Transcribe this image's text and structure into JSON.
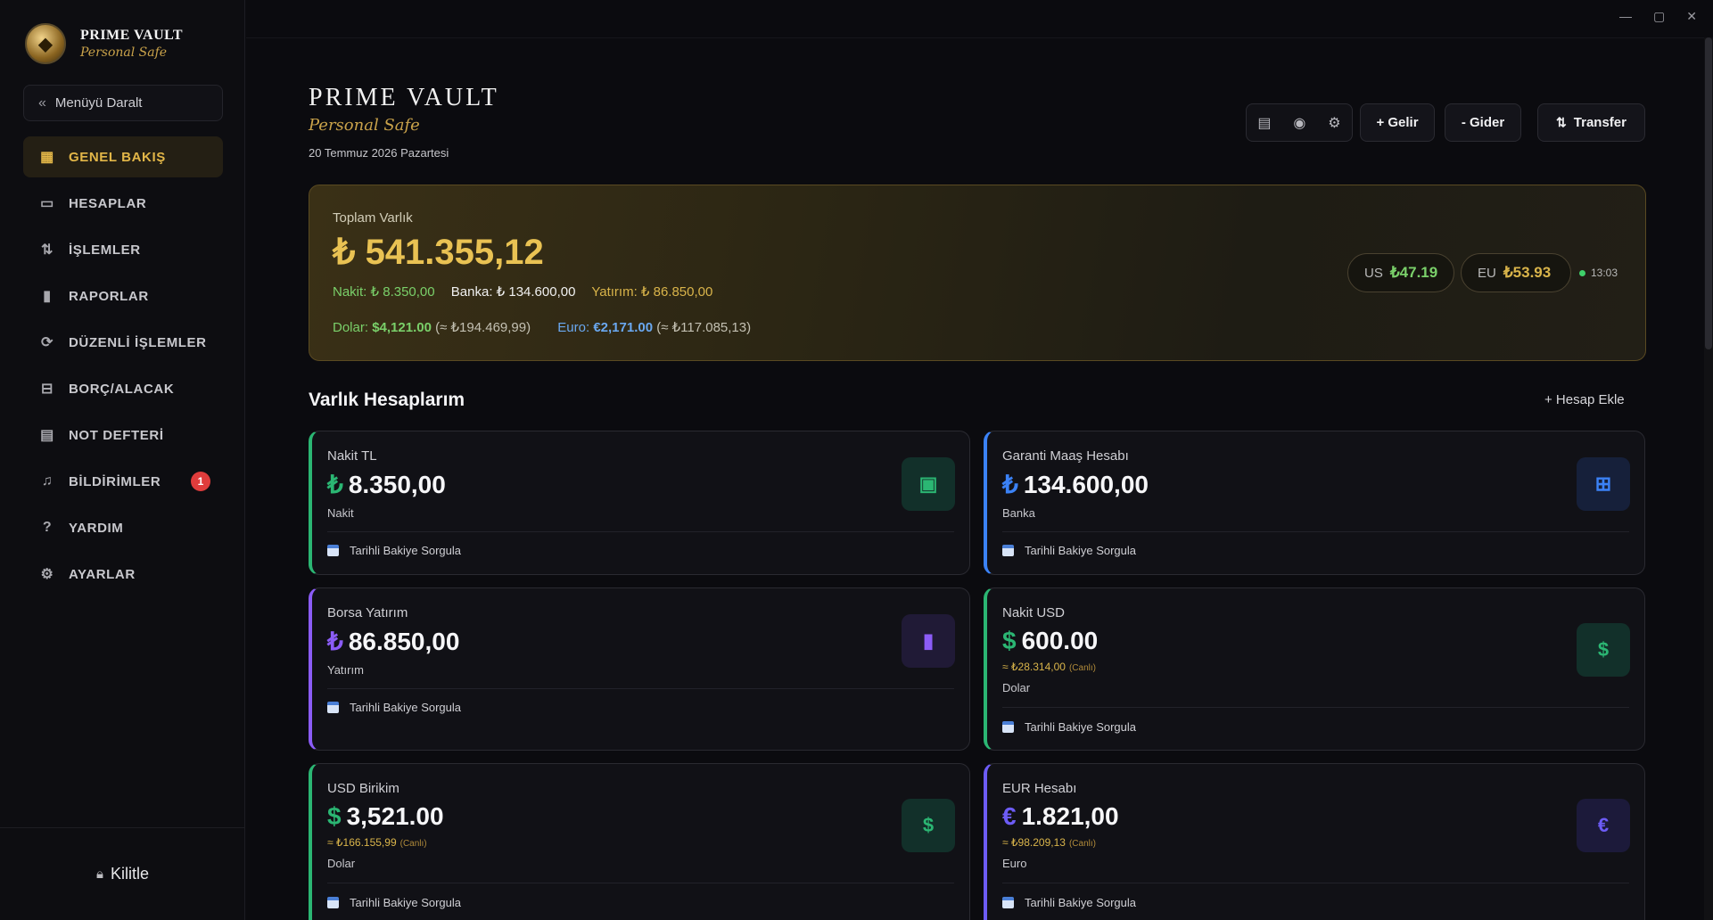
{
  "sidebar": {
    "brand_title": "PRIME VAULT",
    "brand_subtitle": "Personal Safe",
    "collapse_label": "Menüyü Daralt",
    "items": [
      {
        "label": "GENEL BAKIŞ",
        "icon": "grid-icon"
      },
      {
        "label": "HESAPLAR",
        "icon": "credit-card-icon"
      },
      {
        "label": "İŞLEMLER",
        "icon": "arrows-updown-icon"
      },
      {
        "label": "RAPORLAR",
        "icon": "bar-chart-icon"
      },
      {
        "label": "DÜZENLİ İŞLEMLER",
        "icon": "refresh-icon"
      },
      {
        "label": "BORÇ/ALACAK",
        "icon": "debt-icon"
      },
      {
        "label": "NOT DEFTERİ",
        "icon": "notebook-icon"
      },
      {
        "label": "BİLDİRİMLER",
        "icon": "bell-icon",
        "badge": "1"
      },
      {
        "label": "YARDIM",
        "icon": "help-icon"
      },
      {
        "label": "AYARLAR",
        "icon": "gear-icon"
      }
    ],
    "lock_label": "Kilitle"
  },
  "header": {
    "title": "PRIME VAULT",
    "subtitle": "Personal Safe",
    "date": "20 Temmuz 2026 Pazartesi",
    "income_label": "+ Gelir",
    "expense_label": "- Gider",
    "transfer_label": "Transfer"
  },
  "summary": {
    "label": "Toplam Varlık",
    "total": "₺ 541.355,12",
    "cash_label": "Nakit: ₺ 8.350,00",
    "bank_label": "Banka: ₺ 134.600,00",
    "investment_label": "Yatırım: ₺ 86.850,00",
    "usd_prefix": "Dolar:",
    "usd_value": "$4,121.00",
    "usd_try": "(≈ ₺194.469,99)",
    "eur_prefix": "Euro:",
    "eur_value": "€2,171.00",
    "eur_try": "(≈ ₺117.085,13)",
    "rate_us_code": "US",
    "rate_us": "₺47.19",
    "rate_eu_code": "EU",
    "rate_eu": "₺53.93",
    "rate_time": "13:03"
  },
  "accounts_section": {
    "title": "Varlık Hesaplarım",
    "add_label": "+ Hesap Ekle",
    "history_label": "Tarihli Bakiye Sorgula"
  },
  "accounts": [
    {
      "name": "Nakit TL",
      "symbol": "₺",
      "amount": "8.350,00",
      "type": "Nakit",
      "icon": "cash-icon",
      "accent": "#2bb673"
    },
    {
      "name": "Garanti Maaş Hesabı",
      "symbol": "₺",
      "amount": "134.600,00",
      "type": "Banka",
      "icon": "bank-layout-icon",
      "accent": "#3b82f6"
    },
    {
      "name": "Borsa Yatırım",
      "symbol": "₺",
      "amount": "86.850,00",
      "type": "Yatırım",
      "icon": "bar-chart-icon",
      "accent": "#8b5cf6"
    },
    {
      "name": "Nakit USD",
      "symbol": "$",
      "amount": "600.00",
      "conv": "≈ ₺28.314,00",
      "conv_note": "(Canlı)",
      "type": "Dolar",
      "icon": "dollar-icon",
      "accent": "#2bb673"
    },
    {
      "name": "USD Birikim",
      "symbol": "$",
      "amount": "3,521.00",
      "conv": "≈ ₺166.155,99",
      "conv_note": "(Canlı)",
      "type": "Dolar",
      "icon": "dollar-icon",
      "accent": "#2bb673"
    },
    {
      "name": "EUR Hesabı",
      "symbol": "€",
      "amount": "1.821,00",
      "conv": "≈ ₺98.209,13",
      "conv_note": "(Canlı)",
      "type": "Euro",
      "icon": "euro-icon",
      "accent": "#6d5cf6"
    }
  ]
}
